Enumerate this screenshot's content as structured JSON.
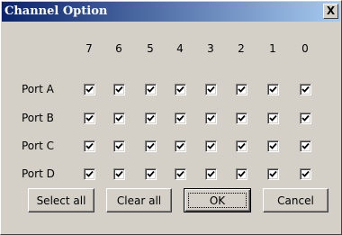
{
  "dialog": {
    "title": "Channel Option",
    "close_label": "X"
  },
  "bits": [
    "7",
    "6",
    "5",
    "4",
    "3",
    "2",
    "1",
    "0"
  ],
  "ports": [
    {
      "label": "Port A",
      "checked": [
        true,
        true,
        true,
        true,
        true,
        true,
        true,
        true
      ]
    },
    {
      "label": "Port B",
      "checked": [
        true,
        true,
        true,
        true,
        true,
        true,
        true,
        true
      ]
    },
    {
      "label": "Port C",
      "checked": [
        true,
        true,
        true,
        true,
        true,
        true,
        true,
        true
      ]
    },
    {
      "label": "Port D",
      "checked": [
        true,
        true,
        true,
        true,
        true,
        true,
        true,
        true
      ]
    }
  ],
  "buttons": {
    "select_all": "Select all",
    "clear_all": "Clear all",
    "ok": "OK",
    "cancel": "Cancel"
  }
}
